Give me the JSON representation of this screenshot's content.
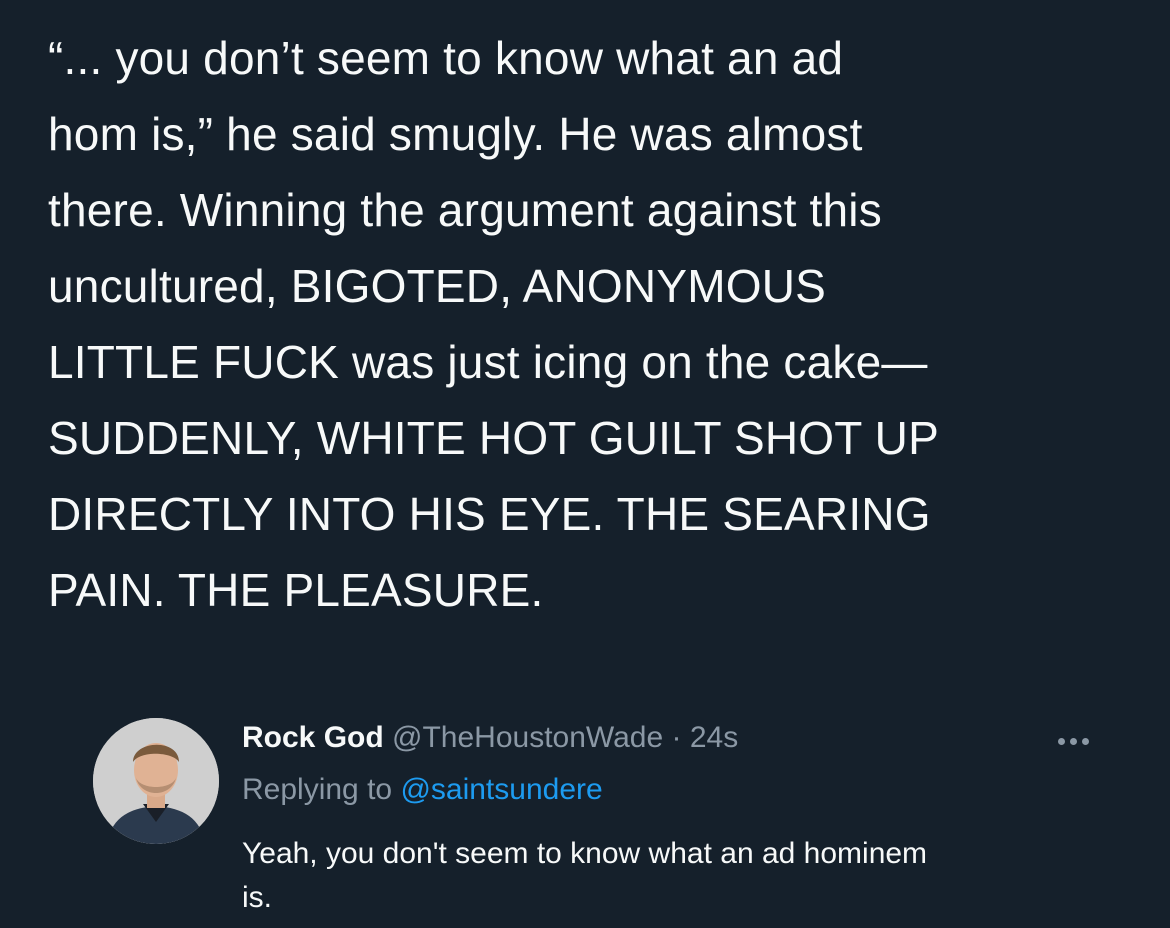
{
  "main_tweet": {
    "lines": [
      "“... you don’t seem to know what an ad",
      "hom is,” he said smugly. He was almost",
      "there. Winning the argument against this",
      "uncultured, BIGOTED, ANONYMOUS",
      "LITTLE FUCK was just icing on the cake—",
      "SUDDENLY, WHITE HOT GUILT SHOT UP",
      "DIRECTLY INTO HIS EYE. THE SEARING",
      "PAIN. THE PLEASURE."
    ]
  },
  "reply": {
    "display_name": "Rock God",
    "handle": "@TheHoustonWade",
    "separator": "·",
    "timestamp": "24s",
    "replying_prefix": "Replying to",
    "replying_to": "@saintsundere",
    "text_lines": [
      "Yeah, you don't seem to know what an ad hominem",
      "is."
    ],
    "icons": {
      "avatar": "profile-photo",
      "more": "more-horizontal-icon"
    }
  },
  "colors": {
    "background": "#15202b",
    "primary_text": "#f7f9f9",
    "secondary_text": "#8b98a5",
    "link": "#1d9bf0"
  }
}
